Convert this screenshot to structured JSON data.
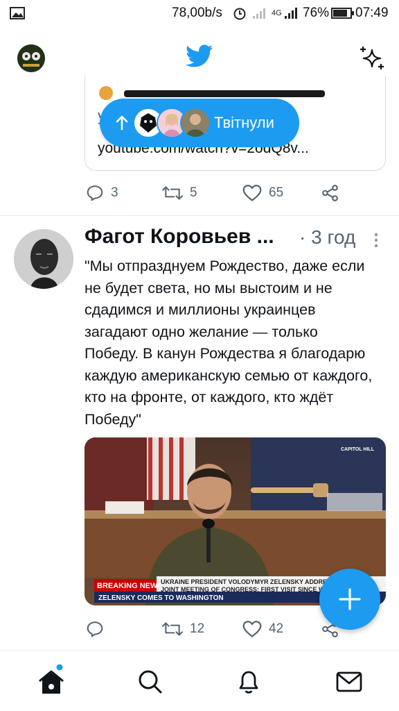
{
  "status_bar": {
    "speed": "78,00b/s",
    "network": "4G",
    "battery": "76%",
    "time": "07:49"
  },
  "header": {
    "logo_icon": "twitter-bird-icon",
    "sparkle_icon": "sparkle-icon",
    "accent": "#1d9bf0"
  },
  "previous_tweet": {
    "card_partial": "y",
    "card_url": "youtube.com/watch?v=2odQ8v...",
    "actions": {
      "replies": "3",
      "retweets": "5",
      "likes": "65"
    }
  },
  "tweeted_pill": {
    "label": "Твітнули"
  },
  "tweet": {
    "name": "Фагот Коровьев ...",
    "time": "· 3 год",
    "text": "\"Мы отпразднуем Рождество, даже если не будет света, но мы выстоим и не сдадимся и миллионы украинцев загадают одно желание — только Победу. В канун Рождества я благодарю каждую американскую семью от каждого, кто на фронте, от каждого, кто ждёт Победу\"",
    "media": {
      "capitol_tag": "CAPITOL HILL",
      "breaking": "BREAKING NEWS",
      "headline_1": "UKRAINE PRESIDENT VOLODYMYR ZELENSKY ADDRESSES",
      "headline_2": "JOINT MEETING OF CONGRESS; FIRST VISIT SINCE WAR ST",
      "lower_third": "ZELENSKY COMES TO WASHINGTON"
    },
    "actions": {
      "retweets": "12",
      "likes": "42"
    }
  },
  "bottom_nav": {
    "items": [
      "home-icon",
      "search-icon",
      "notifications-icon",
      "messages-icon"
    ]
  }
}
